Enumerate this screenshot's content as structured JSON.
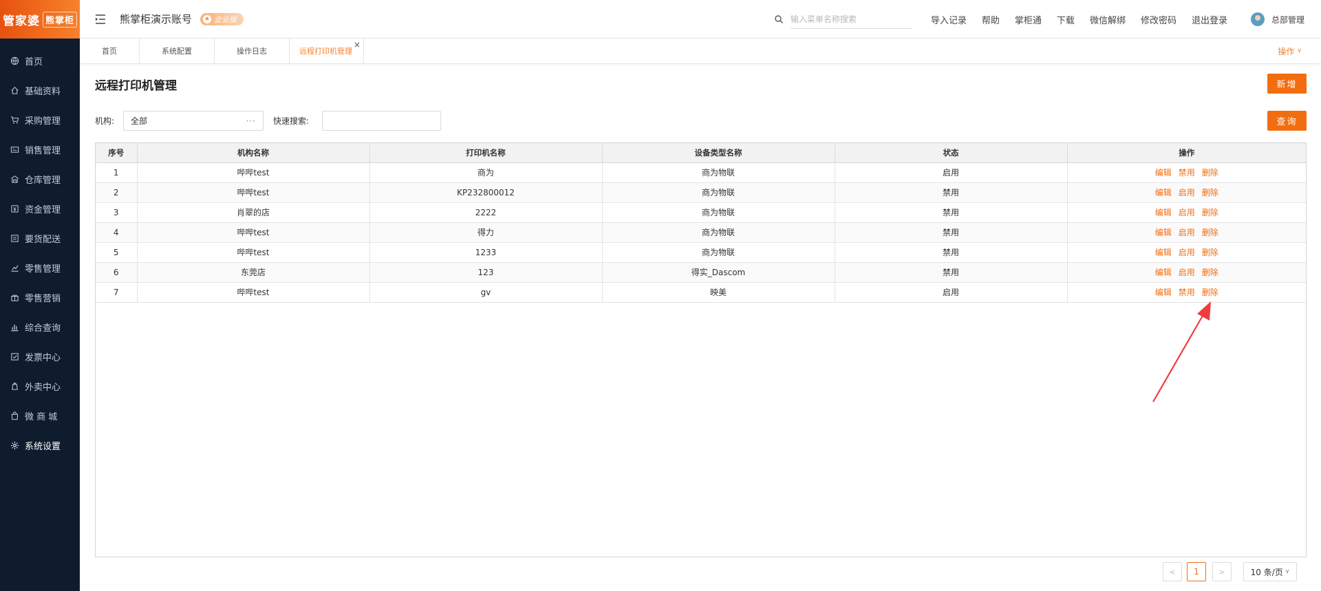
{
  "app": {
    "logo_text": "管家婆",
    "logo_sub": "熊掌柜",
    "account_title": "熊掌柜演示账号",
    "edition_badge": "企业版"
  },
  "sidebar": {
    "items": [
      {
        "label": "首页",
        "icon": "globe-icon"
      },
      {
        "label": "基础资料",
        "icon": "home-icon"
      },
      {
        "label": "采购管理",
        "icon": "cart-icon"
      },
      {
        "label": "销售管理",
        "icon": "sales-icon"
      },
      {
        "label": "仓库管理",
        "icon": "warehouse-icon"
      },
      {
        "label": "资金管理",
        "icon": "fund-icon"
      },
      {
        "label": "要货配送",
        "icon": "delivery-icon"
      },
      {
        "label": "零售管理",
        "icon": "retail-chart-icon"
      },
      {
        "label": "零售营销",
        "icon": "gift-icon"
      },
      {
        "label": "综合查询",
        "icon": "bar-chart-icon"
      },
      {
        "label": "发票中心",
        "icon": "invoice-icon"
      },
      {
        "label": "外卖中心",
        "icon": "takeout-icon"
      },
      {
        "label": "微 商 城",
        "icon": "shop-bag-icon"
      },
      {
        "label": "系统设置",
        "icon": "gear-icon",
        "active": true
      }
    ]
  },
  "header": {
    "search_placeholder": "输入菜单名称搜索",
    "links": [
      "导入记录",
      "帮助",
      "掌柜通",
      "下载",
      "微信解绑",
      "修改密码",
      "退出登录"
    ],
    "user_name": "总部管理"
  },
  "tabs": {
    "items": [
      "首页",
      "系统配置",
      "操作日志",
      "远程打印机管理"
    ],
    "active_index": 3,
    "close_glyph": "×",
    "ops_label": "操作"
  },
  "main": {
    "title": "远程打印机管理",
    "add_button": "新增",
    "query_button": "查询",
    "org_label": "机构:",
    "org_value": "全部",
    "org_dots": "···",
    "quick_search_label": "快速搜索:"
  },
  "table": {
    "columns": [
      "序号",
      "机构名称",
      "打印机名称",
      "设备类型名称",
      "状态",
      "操作"
    ],
    "rows": [
      {
        "no": "1",
        "org": "哔哔test",
        "printer": "商为",
        "type": "商为物联",
        "status": "启用",
        "actions": [
          "编辑",
          "禁用",
          "删除"
        ]
      },
      {
        "no": "2",
        "org": "哔哔test",
        "printer": "KP232800012",
        "type": "商为物联",
        "status": "禁用",
        "actions": [
          "编辑",
          "启用",
          "删除"
        ]
      },
      {
        "no": "3",
        "org": "肖翠的店",
        "printer": "2222",
        "type": "商为物联",
        "status": "禁用",
        "actions": [
          "编辑",
          "启用",
          "删除"
        ]
      },
      {
        "no": "4",
        "org": "哔哔test",
        "printer": "得力",
        "type": "商为物联",
        "status": "禁用",
        "actions": [
          "编辑",
          "启用",
          "删除"
        ]
      },
      {
        "no": "5",
        "org": "哔哔test",
        "printer": "1233",
        "type": "商为物联",
        "status": "禁用",
        "actions": [
          "编辑",
          "启用",
          "删除"
        ]
      },
      {
        "no": "6",
        "org": "东莞店",
        "printer": "123",
        "type": "得实_Dascom",
        "status": "禁用",
        "actions": [
          "编辑",
          "启用",
          "删除"
        ]
      },
      {
        "no": "7",
        "org": "哔哔test",
        "printer": "gv",
        "type": "映美",
        "status": "启用",
        "actions": [
          "编辑",
          "禁用",
          "删除"
        ]
      }
    ]
  },
  "pagination": {
    "prev": "<",
    "current": "1",
    "next": ">",
    "page_size": "10 条/页"
  },
  "colors": {
    "accent": "#f26d0f",
    "sidebar_bg": "#0f1c2e",
    "annotation_arrow": "#f03c3c"
  }
}
